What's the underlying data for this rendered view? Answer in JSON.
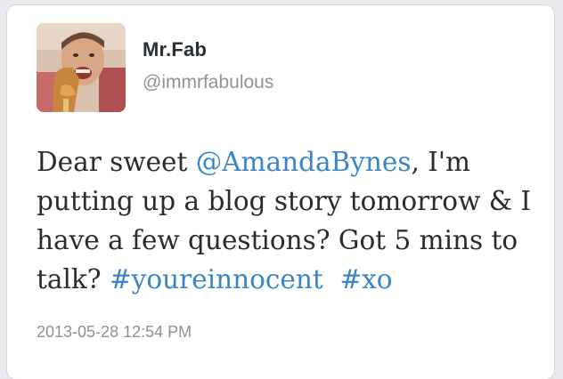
{
  "tweet": {
    "author_name": "Mr.Fab",
    "author_handle": "@immrfabulous",
    "avatar_icon": "user-avatar-photo",
    "text": {
      "before_mention": "Dear sweet ",
      "mention": "@AmandaBynes",
      "middle": ", I'm putting up a blog story tomorrow & I have a few questions? Got 5 mins to talk? ",
      "hashtag1": "#youreinnocent",
      "space": "  ",
      "hashtag2": "#xo"
    },
    "timestamp": "2013-05-28 12:54 PM"
  },
  "colors": {
    "link": "#3a85c6",
    "text": "#2b2b2b",
    "muted": "#8e9297",
    "background": "#e9ebee",
    "card": "#ffffff"
  }
}
